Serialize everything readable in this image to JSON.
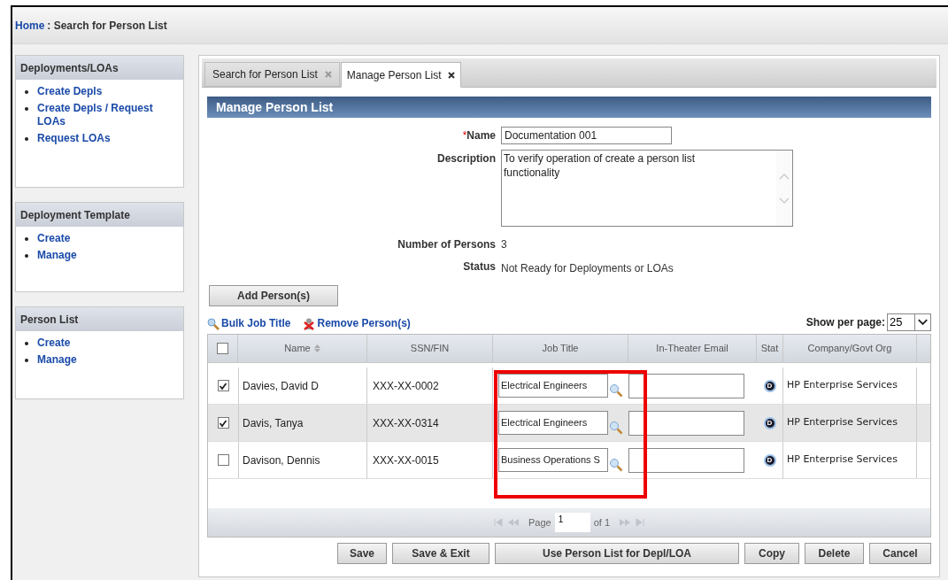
{
  "breadcrumb": {
    "link": "Home",
    "current": ": Search for Person List"
  },
  "sidebar": {
    "panels": [
      {
        "title": "Deployments/LOAs",
        "items": [
          "Create Depls",
          "Create Depls / Request LOAs",
          "Request LOAs"
        ]
      },
      {
        "title": "Deployment Template",
        "items": [
          "Create",
          "Manage"
        ]
      },
      {
        "title": "Person List",
        "items": [
          "Create",
          "Manage"
        ]
      }
    ]
  },
  "tabs": [
    {
      "label": "Search for Person List",
      "selected": false
    },
    {
      "label": "Manage Person List",
      "selected": true
    }
  ],
  "section_title": "Manage Person List",
  "form": {
    "name": {
      "label": "Name",
      "required_mark": "*",
      "value": "Documentation 001"
    },
    "description": {
      "label": "Description",
      "value": "To verify operation of create a person list functionality"
    },
    "number_of_persons": {
      "label": "Number of Persons",
      "value": "3"
    },
    "status": {
      "label": "Status",
      "value": "Not Ready for Deployments or LOAs"
    }
  },
  "add_button": "Add Person(s)",
  "links": [
    {
      "label": "Bulk Job Title",
      "kind": "search"
    },
    {
      "label": "Remove Person(s)",
      "kind": "remove"
    }
  ],
  "show_per_page": {
    "label": "Show per page:",
    "value": "25"
  },
  "table": {
    "select_all_checked": false,
    "columns": [
      {
        "label": "Name",
        "sortable": true
      },
      {
        "label": "SSN/FIN",
        "sortable": false
      },
      {
        "label": "Job Title",
        "sortable": false
      },
      {
        "label": "In-Theater Email",
        "sortable": false
      },
      {
        "label": "Stat",
        "sortable": false
      },
      {
        "label": "Company/Govt Org",
        "sortable": false
      }
    ],
    "rows": [
      {
        "checked": true,
        "name": "Davies, David D",
        "ssn": "XXX-XX-0002",
        "job_title": "Electrical Engineers",
        "status_badge": "D",
        "company": "HP Enterprise Services"
      },
      {
        "checked": true,
        "name": "Davis, Tanya",
        "ssn": "XXX-XX-0314",
        "job_title": "Electrical Engineers",
        "status_badge": "D",
        "company": "HP Enterprise Services"
      },
      {
        "checked": false,
        "name": "Davison, Dennis",
        "ssn": "XXX-XX-0015",
        "job_title": "Business Operations S",
        "status_badge": "D",
        "company": "HP Enterprise Services"
      }
    ]
  },
  "pager": {
    "page_label": "Page",
    "page": "1",
    "of_label": "of 1"
  },
  "buttons": [
    "Save",
    "Save & Exit",
    "Use Person List for Depl/LOA",
    "Copy",
    "Delete",
    "Cancel"
  ]
}
